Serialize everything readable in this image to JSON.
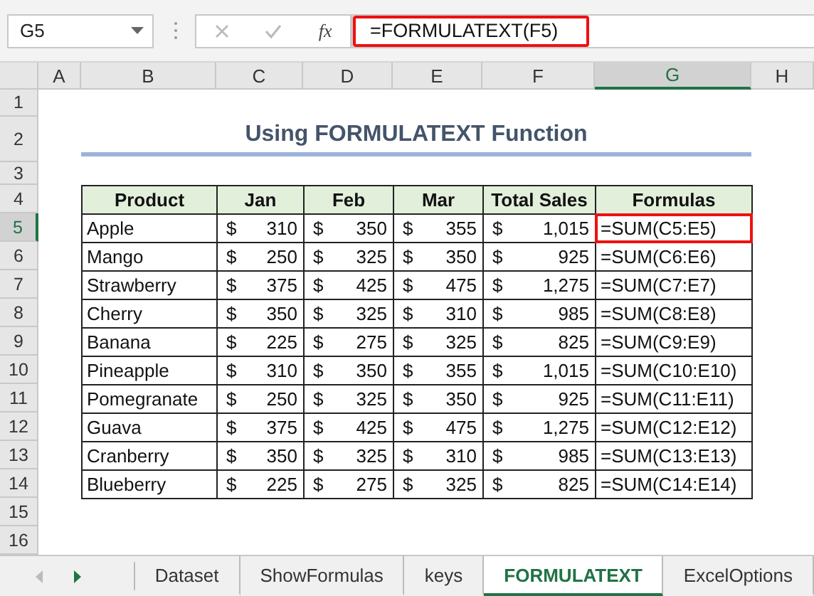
{
  "formula_bar": {
    "name_box": "G5",
    "function_label": "fx",
    "formula": "=FORMULATEXT(F5)",
    "annotated": true
  },
  "column_headers": [
    {
      "label": "A",
      "selected": false
    },
    {
      "label": "B",
      "selected": false
    },
    {
      "label": "C",
      "selected": false
    },
    {
      "label": "D",
      "selected": false
    },
    {
      "label": "E",
      "selected": false
    },
    {
      "label": "F",
      "selected": false
    },
    {
      "label": "G",
      "selected": true
    },
    {
      "label": "H",
      "selected": false
    }
  ],
  "row_headers": [
    {
      "label": "1",
      "selected": false
    },
    {
      "label": "2",
      "selected": false
    },
    {
      "label": "3",
      "selected": false
    },
    {
      "label": "4",
      "selected": false
    },
    {
      "label": "5",
      "selected": true
    },
    {
      "label": "6",
      "selected": false
    },
    {
      "label": "7",
      "selected": false
    },
    {
      "label": "8",
      "selected": false
    },
    {
      "label": "9",
      "selected": false
    },
    {
      "label": "10",
      "selected": false
    },
    {
      "label": "11",
      "selected": false
    },
    {
      "label": "12",
      "selected": false
    },
    {
      "label": "13",
      "selected": false
    },
    {
      "label": "14",
      "selected": false
    },
    {
      "label": "15",
      "selected": false
    },
    {
      "label": "16",
      "selected": false
    }
  ],
  "title": "Using FORMULATEXT Function",
  "table": {
    "columns": [
      "Product",
      "Jan",
      "Feb",
      "Mar",
      "Total Sales",
      "Formulas"
    ],
    "rows": [
      {
        "product": "Apple",
        "values": [
          {
            "symbol": "$",
            "amount": "310"
          },
          {
            "symbol": "$",
            "amount": "350"
          },
          {
            "symbol": "$",
            "amount": "355"
          },
          {
            "symbol": "$",
            "amount": "1,015"
          }
        ],
        "formula": "=SUM(C5:E5)",
        "annotated": true
      },
      {
        "product": "Mango",
        "values": [
          {
            "symbol": "$",
            "amount": "250"
          },
          {
            "symbol": "$",
            "amount": "325"
          },
          {
            "symbol": "$",
            "amount": "350"
          },
          {
            "symbol": "$",
            "amount": "925"
          }
        ],
        "formula": "=SUM(C6:E6)",
        "annotated": false
      },
      {
        "product": "Strawberry",
        "values": [
          {
            "symbol": "$",
            "amount": "375"
          },
          {
            "symbol": "$",
            "amount": "425"
          },
          {
            "symbol": "$",
            "amount": "475"
          },
          {
            "symbol": "$",
            "amount": "1,275"
          }
        ],
        "formula": "=SUM(C7:E7)",
        "annotated": false
      },
      {
        "product": "Cherry",
        "values": [
          {
            "symbol": "$",
            "amount": "350"
          },
          {
            "symbol": "$",
            "amount": "325"
          },
          {
            "symbol": "$",
            "amount": "310"
          },
          {
            "symbol": "$",
            "amount": "985"
          }
        ],
        "formula": "=SUM(C8:E8)",
        "annotated": false
      },
      {
        "product": "Banana",
        "values": [
          {
            "symbol": "$",
            "amount": "225"
          },
          {
            "symbol": "$",
            "amount": "275"
          },
          {
            "symbol": "$",
            "amount": "325"
          },
          {
            "symbol": "$",
            "amount": "825"
          }
        ],
        "formula": "=SUM(C9:E9)",
        "annotated": false
      },
      {
        "product": "Pineapple",
        "values": [
          {
            "symbol": "$",
            "amount": "310"
          },
          {
            "symbol": "$",
            "amount": "350"
          },
          {
            "symbol": "$",
            "amount": "355"
          },
          {
            "symbol": "$",
            "amount": "1,015"
          }
        ],
        "formula": "=SUM(C10:E10)",
        "annotated": false
      },
      {
        "product": "Pomegranate",
        "values": [
          {
            "symbol": "$",
            "amount": "250"
          },
          {
            "symbol": "$",
            "amount": "325"
          },
          {
            "symbol": "$",
            "amount": "350"
          },
          {
            "symbol": "$",
            "amount": "925"
          }
        ],
        "formula": "=SUM(C11:E11)",
        "annotated": false
      },
      {
        "product": "Guava",
        "values": [
          {
            "symbol": "$",
            "amount": "375"
          },
          {
            "symbol": "$",
            "amount": "425"
          },
          {
            "symbol": "$",
            "amount": "475"
          },
          {
            "symbol": "$",
            "amount": "1,275"
          }
        ],
        "formula": "=SUM(C12:E12)",
        "annotated": false
      },
      {
        "product": "Cranberry",
        "values": [
          {
            "symbol": "$",
            "amount": "350"
          },
          {
            "symbol": "$",
            "amount": "325"
          },
          {
            "symbol": "$",
            "amount": "310"
          },
          {
            "symbol": "$",
            "amount": "985"
          }
        ],
        "formula": "=SUM(C13:E13)",
        "annotated": false
      },
      {
        "product": "Blueberry",
        "values": [
          {
            "symbol": "$",
            "amount": "225"
          },
          {
            "symbol": "$",
            "amount": "275"
          },
          {
            "symbol": "$",
            "amount": "325"
          },
          {
            "symbol": "$",
            "amount": "825"
          }
        ],
        "formula": "=SUM(C14:E14)",
        "annotated": false
      }
    ]
  },
  "sheet_tabs": [
    {
      "label": "Dataset",
      "selected": false
    },
    {
      "label": "ShowFormulas",
      "selected": false
    },
    {
      "label": "keys",
      "selected": false
    },
    {
      "label": "FORMULATEXT",
      "selected": true
    },
    {
      "label": "ExcelOptions",
      "selected": false
    }
  ]
}
